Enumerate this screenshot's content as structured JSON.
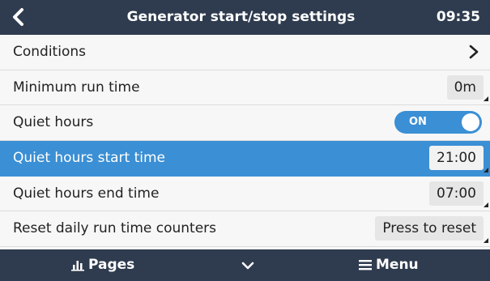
{
  "header": {
    "title": "Generator start/stop settings",
    "time": "09:35"
  },
  "rows": [
    {
      "label": "Conditions"
    },
    {
      "label": "Minimum run time",
      "value": "0m"
    },
    {
      "label": "Quiet hours",
      "toggle": "ON"
    },
    {
      "label": "Quiet hours start time",
      "value": "21:00"
    },
    {
      "label": "Quiet hours end time",
      "value": "07:00"
    },
    {
      "label": "Reset daily run time counters",
      "button": "Press to reset"
    }
  ],
  "footer": {
    "pages_label": "Pages",
    "menu_label": "Menu"
  },
  "colors": {
    "header_bg": "#2f3c4f",
    "accent": "#3b8fd4",
    "row_bg": "#f7f7f7"
  },
  "icons": [
    "back-arrow-icon",
    "chevron-right-icon",
    "pages-chart-icon",
    "chevron-down-icon",
    "menu-hamburger-icon"
  ]
}
